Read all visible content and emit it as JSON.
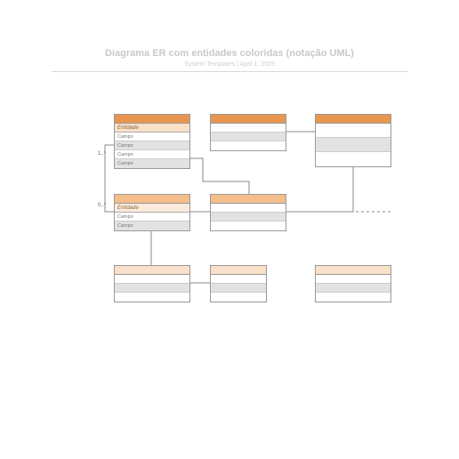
{
  "header": {
    "title": "Diagrama ER com entidades coloridas (notação UML)",
    "subtitle": "System Templates  |  April 1, 2025"
  },
  "mult": {
    "top": "1..*",
    "bottom": "0..*"
  },
  "entities": {
    "e1": {
      "name": "Entidade",
      "fields": [
        "Campo",
        "Campo",
        "Campo",
        "Campo"
      ]
    },
    "e2": {
      "name": "",
      "fields": [
        "",
        "",
        ""
      ]
    },
    "e3": {
      "name": "",
      "fields": [
        "",
        "",
        ""
      ]
    },
    "e4": {
      "name": "Entidade",
      "fields": [
        "Campo",
        "Campo"
      ]
    },
    "e5": {
      "name": "",
      "fields": [
        "",
        "",
        ""
      ]
    },
    "e6": {
      "name": "",
      "fields": [
        "",
        "",
        ""
      ]
    },
    "e7": {
      "name": "",
      "fields": [
        "",
        "",
        ""
      ]
    },
    "e8": {
      "name": "",
      "fields": [
        "",
        "",
        ""
      ]
    }
  }
}
